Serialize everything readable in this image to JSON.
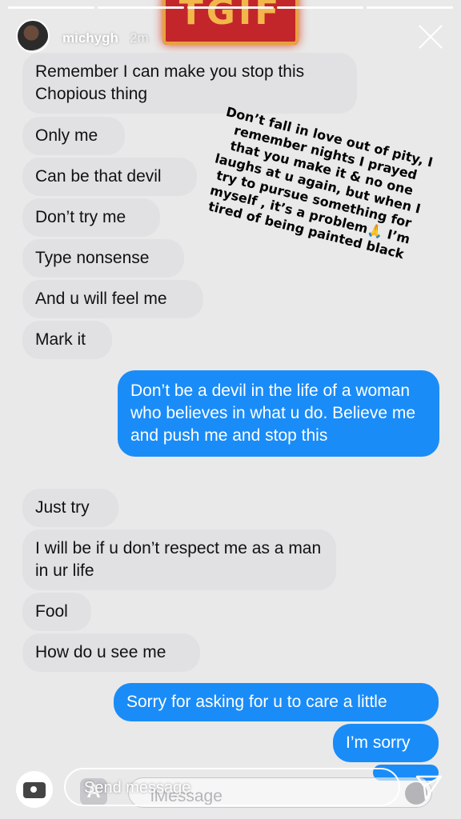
{
  "story": {
    "username": "michygh",
    "time": "2m",
    "sign_text": "TGIF",
    "overlay_text": "Don’t fall in love out of pity, I remember nights I prayed that you make it & no one laughs at u again, but when I try to pursue something for myself , it’s a problem🙏 I’m tired of being painted black"
  },
  "messages": [
    {
      "dir": "in",
      "text": "Remember I can make you stop this Chopious thing"
    },
    {
      "dir": "in",
      "text": "Only me"
    },
    {
      "dir": "in",
      "text": "Can be that devil"
    },
    {
      "dir": "in",
      "text": "Don’t try me"
    },
    {
      "dir": "in",
      "text": "Type nonsense"
    },
    {
      "dir": "in",
      "text": "And u will feel me"
    },
    {
      "dir": "in",
      "text": "Mark it"
    },
    {
      "dir": "out",
      "text": "Don’t be a devil in the life of a woman who believes in what u do. Believe me and push me and stop this"
    },
    {
      "dir": "in",
      "text": "Just try"
    },
    {
      "dir": "in",
      "text": "I will be if u don’t respect me as a man in ur life"
    },
    {
      "dir": "in",
      "text": "Fool"
    },
    {
      "dir": "in",
      "text": "How do u see me"
    },
    {
      "dir": "out",
      "text": "Sorry for asking for u to care a little"
    },
    {
      "dir": "out",
      "text": "I’m sorry"
    }
  ],
  "imessage": {
    "placeholder": "iMessage",
    "app_icon": "A"
  },
  "reply": {
    "placeholder": "Send message"
  },
  "colors": {
    "outgoing": "#1a8cf8",
    "incoming": "#e1e1e4",
    "background": "#e9e9ea"
  }
}
